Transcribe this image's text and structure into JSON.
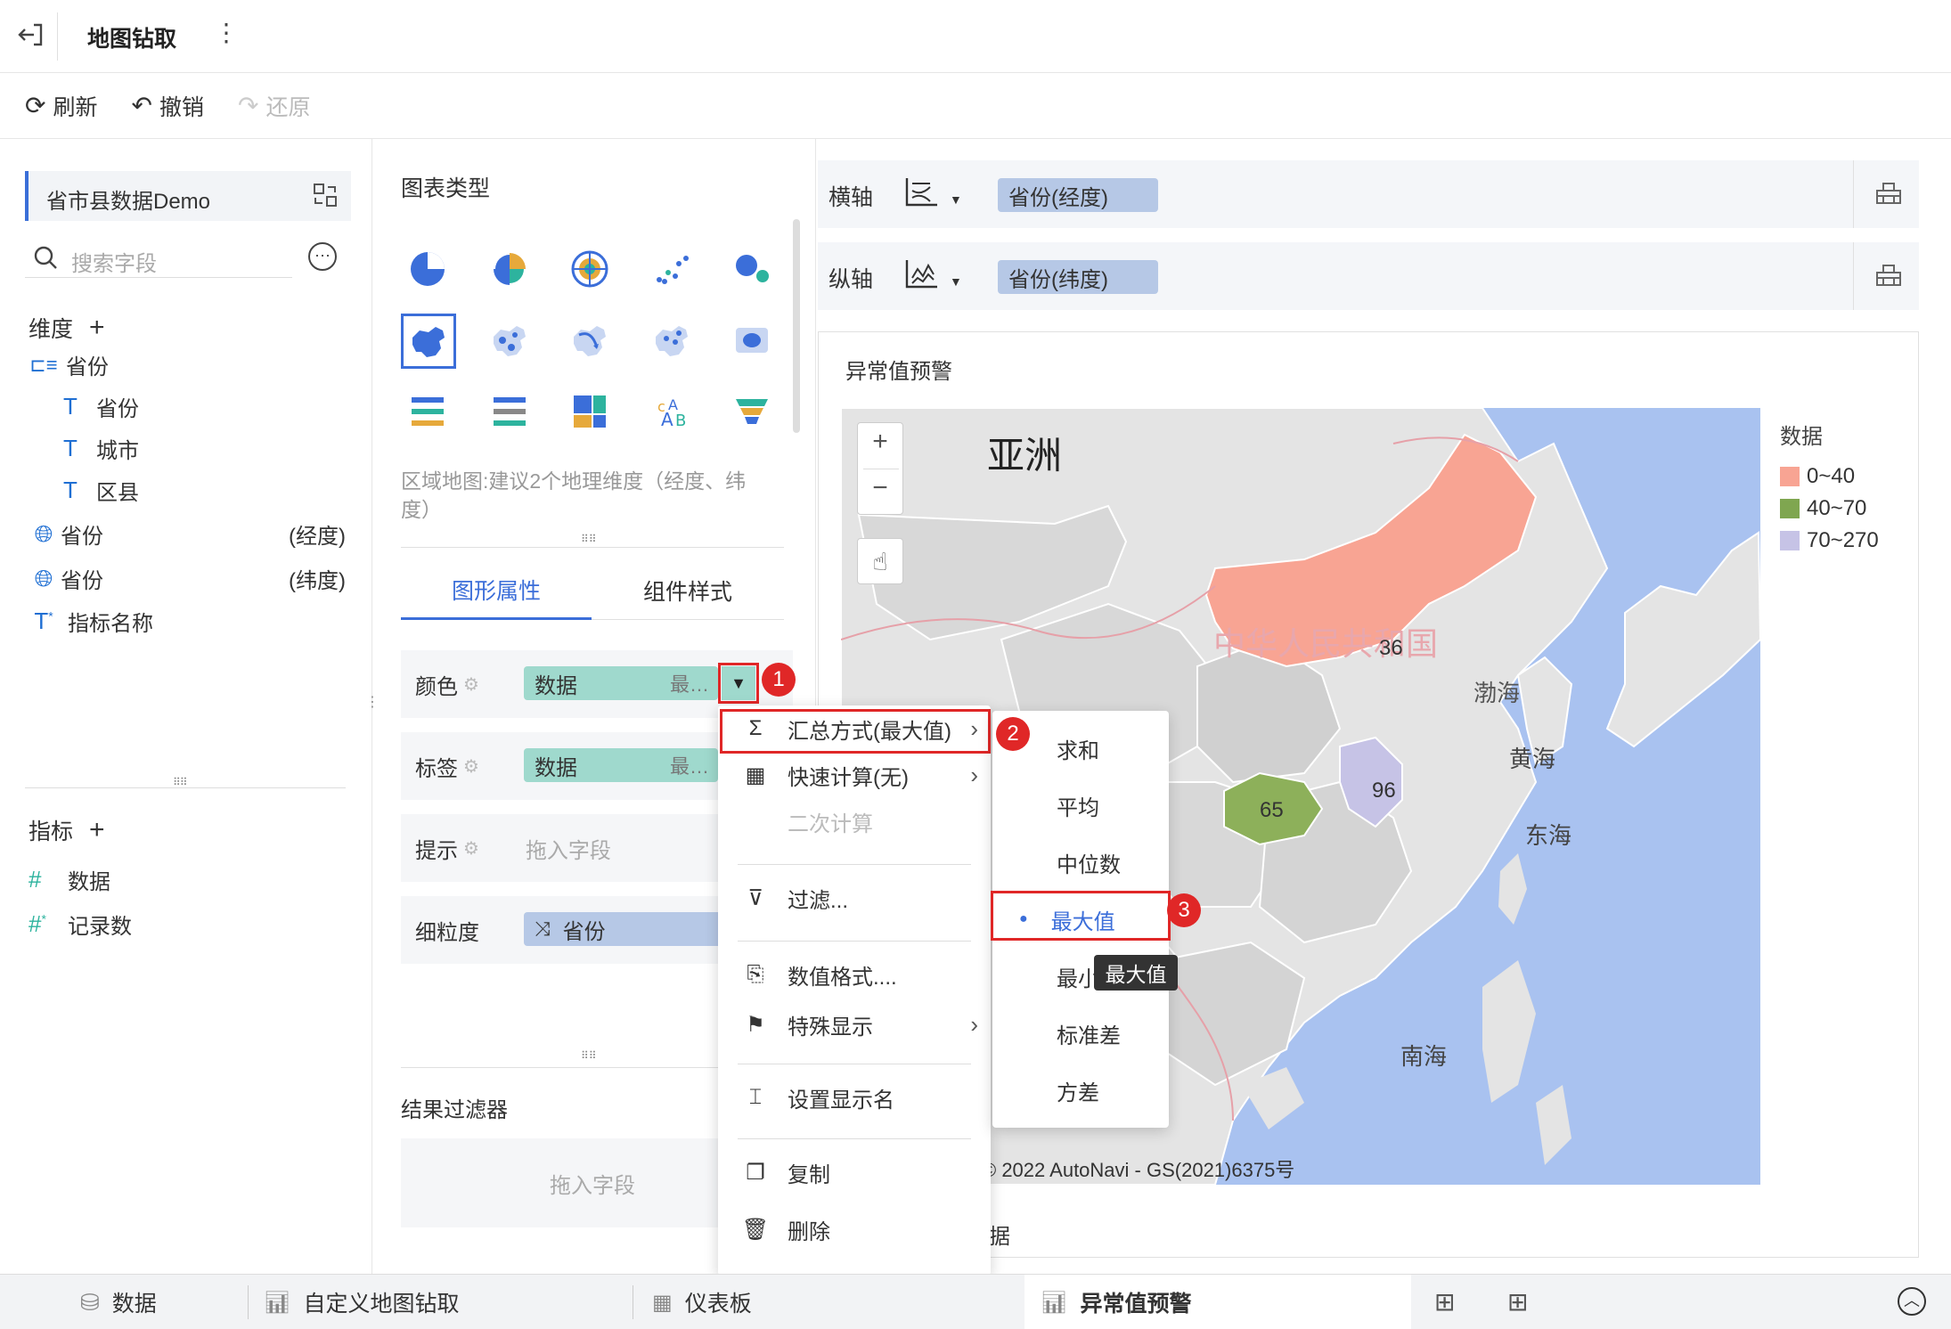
{
  "header": {
    "title": "地图钻取"
  },
  "toolbar": {
    "refresh": "刷新",
    "undo": "撤销",
    "redo": "还原"
  },
  "left": {
    "dataset": "省市县数据Demo",
    "search_placeholder": "搜索字段",
    "dimension_title": "维度",
    "dimensions": [
      {
        "name": "省份",
        "type": "hierarchy"
      },
      {
        "name": "省份",
        "type": "text"
      },
      {
        "name": "城市",
        "type": "text"
      },
      {
        "name": "区县",
        "type": "text"
      },
      {
        "name": "省份",
        "suffix": "(经度)",
        "type": "geo"
      },
      {
        "name": "省份",
        "suffix": "(纬度)",
        "type": "geo"
      },
      {
        "name": "指标名称",
        "type": "text-star"
      }
    ],
    "measure_title": "指标",
    "measures": [
      {
        "name": "数据",
        "type": "hash"
      },
      {
        "name": "记录数",
        "type": "hash-star"
      }
    ]
  },
  "middle": {
    "chart_type_title": "图表类型",
    "hint": "区域地图:建议2个地理维度（经度、纬度）",
    "tabs": [
      "图形属性",
      "组件样式"
    ],
    "active_tab": 0,
    "props": {
      "color_label": "颜色",
      "color_field": "数据",
      "color_agg": "最…",
      "label_label": "标签",
      "label_field": "数据",
      "label_agg": "最…",
      "tooltip_label": "提示",
      "tooltip_placeholder": "拖入字段",
      "granularity_label": "细粒度",
      "granularity_field": "省份"
    },
    "filter_title": "结果过滤器",
    "filter_placeholder": "拖入字段"
  },
  "axes": {
    "x_label": "横轴",
    "x_field": "省份(经度)",
    "y_label": "纵轴",
    "y_field": "省份(纬度)"
  },
  "chart": {
    "title": "异常值预警",
    "map_labels": {
      "asia": "亚洲",
      "country": "中华人民共和国",
      "bohai": "渤海",
      "yellow_sea": "黄海",
      "east_sea": "东海",
      "south_sea": "南海"
    },
    "values": [
      {
        "value": "36",
        "color": "#f8a493"
      },
      {
        "value": "65",
        "color": "#8db05a"
      },
      {
        "value": "96",
        "color": "#c6c3e6"
      }
    ],
    "legend_title": "数据",
    "legend": [
      {
        "label": "0~40",
        "color": "#f8a493"
      },
      {
        "label": "40~70",
        "color": "#7fa650"
      },
      {
        "label": "70~270",
        "color": "#c6c3e6"
      }
    ],
    "zoom_in": "+",
    "zoom_out": "−",
    "copyright": "© 2022 AutoNavi - GS(2021)6375号",
    "footer_partial": "据"
  },
  "context_menu": {
    "items": [
      "汇总方式(最大值)",
      "快速计算(无)",
      "二次计算",
      "过滤...",
      "数值格式....",
      "特殊显示",
      "设置显示名",
      "复制",
      "删除"
    ]
  },
  "submenu": {
    "items": [
      "求和",
      "平均",
      "中位数",
      "最大值",
      "最小值",
      "标准差",
      "方差"
    ],
    "selected": 3,
    "tooltip": "最大值",
    "min_partial": "最小"
  },
  "badges": [
    "1",
    "2",
    "3"
  ],
  "bottom_tabs": [
    {
      "label": "数据"
    },
    {
      "label": "自定义地图钻取"
    },
    {
      "label": "仪表板"
    },
    {
      "label": "异常值预警",
      "active": true
    }
  ]
}
